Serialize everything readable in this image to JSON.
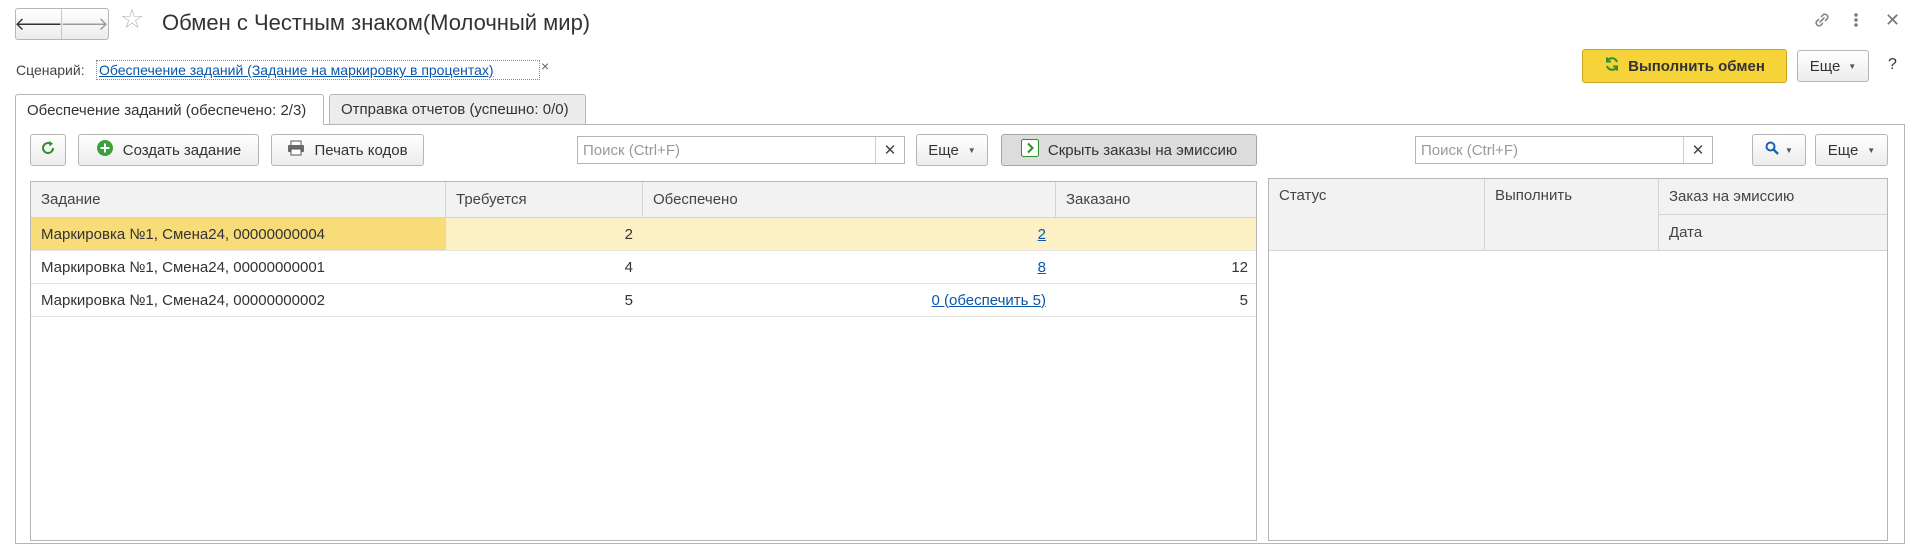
{
  "window": {
    "title": "Обмен с Честным знаком(Молочный мир)",
    "back_icon": "arrow-left",
    "forward_icon": "arrow-right",
    "favorite_icon": "star",
    "link_icon": "link",
    "menu_icon": "vertical-dots",
    "close_icon": "close"
  },
  "scenario": {
    "label": "Сценарий:",
    "value": "Обеспечение заданий (Задание на маркировку в процентах)",
    "clear": "×"
  },
  "header_actions": {
    "execute_label": "Выполнить обмен",
    "execute_color": "#f7d33a",
    "more_label": "Еще",
    "help_label": "?"
  },
  "tabs": [
    {
      "label": "Обеспечение заданий (обеспечено: 2/3)",
      "active": true
    },
    {
      "label": "Отправка отчетов (успешно: 0/0)",
      "active": false
    }
  ],
  "left_toolbar": {
    "refresh_icon": "refresh",
    "create_label": "Создать задание",
    "print_label": "Печать кодов",
    "search_placeholder": "Поиск (Ctrl+F)",
    "more_label": "Еще",
    "hide_orders_label": "Скрыть заказы на эмиссию"
  },
  "right_toolbar": {
    "search_placeholder": "Поиск (Ctrl+F)",
    "more_label": "Еще"
  },
  "tasks_table": {
    "columns": [
      "Задание",
      "Требуется",
      "Обеспечено",
      "Заказано"
    ],
    "rows": [
      {
        "task": "Маркировка №1, Смена24, 00000000004",
        "required": "2",
        "provided": "2",
        "ordered": "",
        "selected": true
      },
      {
        "task": "Маркировка №1, Смена24, 00000000001",
        "required": "4",
        "provided": "8",
        "ordered": "12",
        "selected": false
      },
      {
        "task": "Маркировка №1, Смена24, 00000000002",
        "required": "5",
        "provided": "0 (обеспечить 5)",
        "ordered": "5",
        "selected": false
      }
    ]
  },
  "orders_table": {
    "columns": [
      "Статус",
      "Выполнить",
      "Заказ на эмиссию"
    ],
    "subcolumn": "Дата"
  },
  "colors": {
    "selected_row": "#fbf1c4",
    "selected_cell": "#f8dc7a",
    "link": "#0b56a8"
  }
}
